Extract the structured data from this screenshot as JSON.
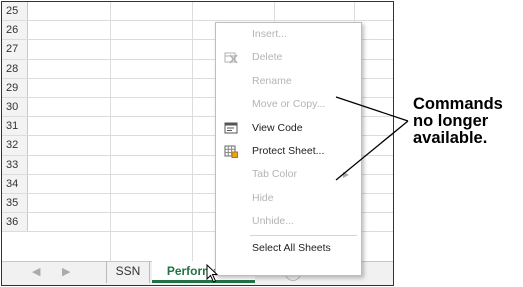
{
  "spreadsheet": {
    "row_numbers": [
      "25",
      "26",
      "27",
      "28",
      "29",
      "30",
      "31",
      "32",
      "33",
      "34",
      "35",
      "36"
    ],
    "accent_color": "#217346"
  },
  "tabs": {
    "nav_prev": "◀",
    "nav_next": "▶",
    "items": [
      {
        "label": "SSN"
      },
      {
        "label": "Performance",
        "active": true
      }
    ],
    "add_sheet_glyph": "+"
  },
  "context_menu": {
    "items": [
      {
        "label": "Insert...",
        "enabled": false,
        "icon": null
      },
      {
        "label": "Delete",
        "enabled": false,
        "icon": "delete-sheet-icon"
      },
      {
        "label": "Rename",
        "enabled": false,
        "icon": null
      },
      {
        "label": "Move or Copy...",
        "enabled": false,
        "icon": null
      },
      {
        "label": "View Code",
        "enabled": true,
        "icon": "view-code-icon"
      },
      {
        "label": "Protect Sheet...",
        "enabled": true,
        "icon": "protect-sheet-icon"
      },
      {
        "label": "Tab Color",
        "enabled": false,
        "icon": null,
        "submenu": true
      },
      {
        "label": "Hide",
        "enabled": false,
        "icon": null
      },
      {
        "label": "Unhide...",
        "enabled": false,
        "icon": null
      },
      {
        "label": "Select All Sheets",
        "enabled": true,
        "icon": null
      }
    ]
  },
  "callout": {
    "line1": "Commands",
    "line2": "no longer",
    "line3": "available."
  }
}
